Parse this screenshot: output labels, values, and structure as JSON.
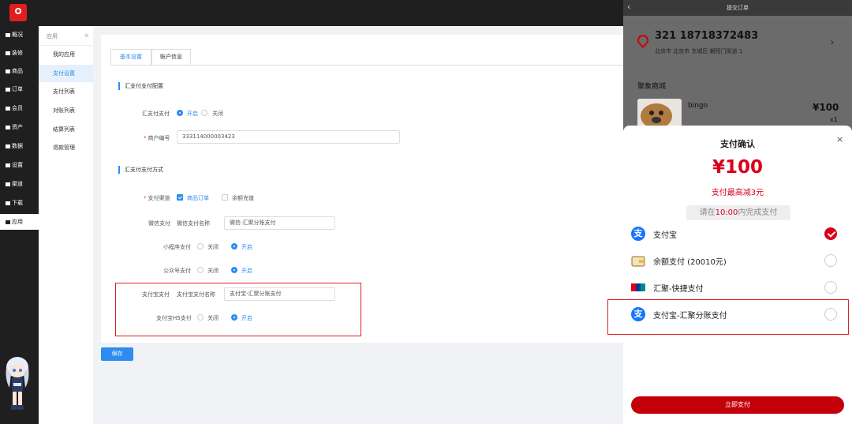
{
  "left_nav": {
    "items": [
      {
        "label": "概况",
        "active": false
      },
      {
        "label": "装修",
        "active": false
      },
      {
        "label": "商品",
        "active": false
      },
      {
        "label": "订单",
        "active": false
      },
      {
        "label": "会员",
        "active": false
      },
      {
        "label": "资产",
        "active": false
      },
      {
        "label": "数据",
        "active": false
      },
      {
        "label": "设置",
        "active": false
      },
      {
        "label": "渠道",
        "active": false
      },
      {
        "label": "下载",
        "active": false
      },
      {
        "label": "应用",
        "active": true
      }
    ]
  },
  "sub_nav": {
    "header": "应用",
    "items": [
      {
        "label": "我的应用",
        "active": false
      },
      {
        "label": "支付设置",
        "active": true
      },
      {
        "label": "支付列表",
        "active": false
      },
      {
        "label": "对账列表",
        "active": false
      },
      {
        "label": "结算列表",
        "active": false
      },
      {
        "label": "退款管理",
        "active": false
      }
    ]
  },
  "tabs": [
    {
      "label": "基本设置",
      "active": true
    },
    {
      "label": "账户信息",
      "active": false
    }
  ],
  "config": {
    "section1_title": "汇支付支付配置",
    "enable_label": "汇支付支付",
    "enable_on": "开启",
    "enable_off": "关闭",
    "merchant_label": "商户编号",
    "merchant_value": "333114000003423",
    "section2_title": "汇支付支付方式",
    "channel_label": "支付渠道",
    "channel_goods": "商品订单",
    "channel_recharge": "余额充值",
    "wechat_label": "微信支付",
    "wechat_name_label": "微信支付名称",
    "wechat_name_value": "微信-汇聚分账支付",
    "miniapp_label": "小程序支付",
    "miniapp_off": "关闭",
    "miniapp_on": "开启",
    "mp_label": "公众号支付",
    "mp_off": "关闭",
    "mp_on": "开启",
    "alipay_label": "支付宝支付",
    "alipay_name_label": "支付宝支付名称",
    "alipay_name_value": "支付宝-汇聚分账支付",
    "alipay_h5_label": "支付宝H5支付",
    "alipay_h5_off": "关闭",
    "alipay_h5_on": "开启"
  },
  "save_label": "保存",
  "phone": {
    "header_title": "提交订单",
    "address_name": "321 18718372483",
    "address_detail": "北京市 北京市 东城区 朝阳门街道 1",
    "shop_name": "聚象商城",
    "product_name": "bingo",
    "product_price": "¥100",
    "product_qty": "x1",
    "modal": {
      "title": "支付确认",
      "amount": "¥100",
      "discount": "支付最高减3元",
      "timer_prefix": "请在",
      "timer_value": "10:00",
      "timer_suffix": "内完成支付",
      "methods": [
        {
          "label": "支付宝",
          "icon": "alipay-icon",
          "selected": true
        },
        {
          "label": "余额支付 (20010元)",
          "icon": "wallet-icon",
          "selected": false
        },
        {
          "label": "汇聚-快捷支付",
          "icon": "unionpay-icon",
          "selected": false
        },
        {
          "label": "支付宝-汇聚分账支付",
          "icon": "alipay-icon",
          "selected": false
        }
      ],
      "pay_button": "立即支付"
    }
  },
  "colors": {
    "accent_blue": "#2d8cf0",
    "highlight_red": "#e02020",
    "price_red": "#d9001b",
    "pay_button": "#c4000b"
  }
}
